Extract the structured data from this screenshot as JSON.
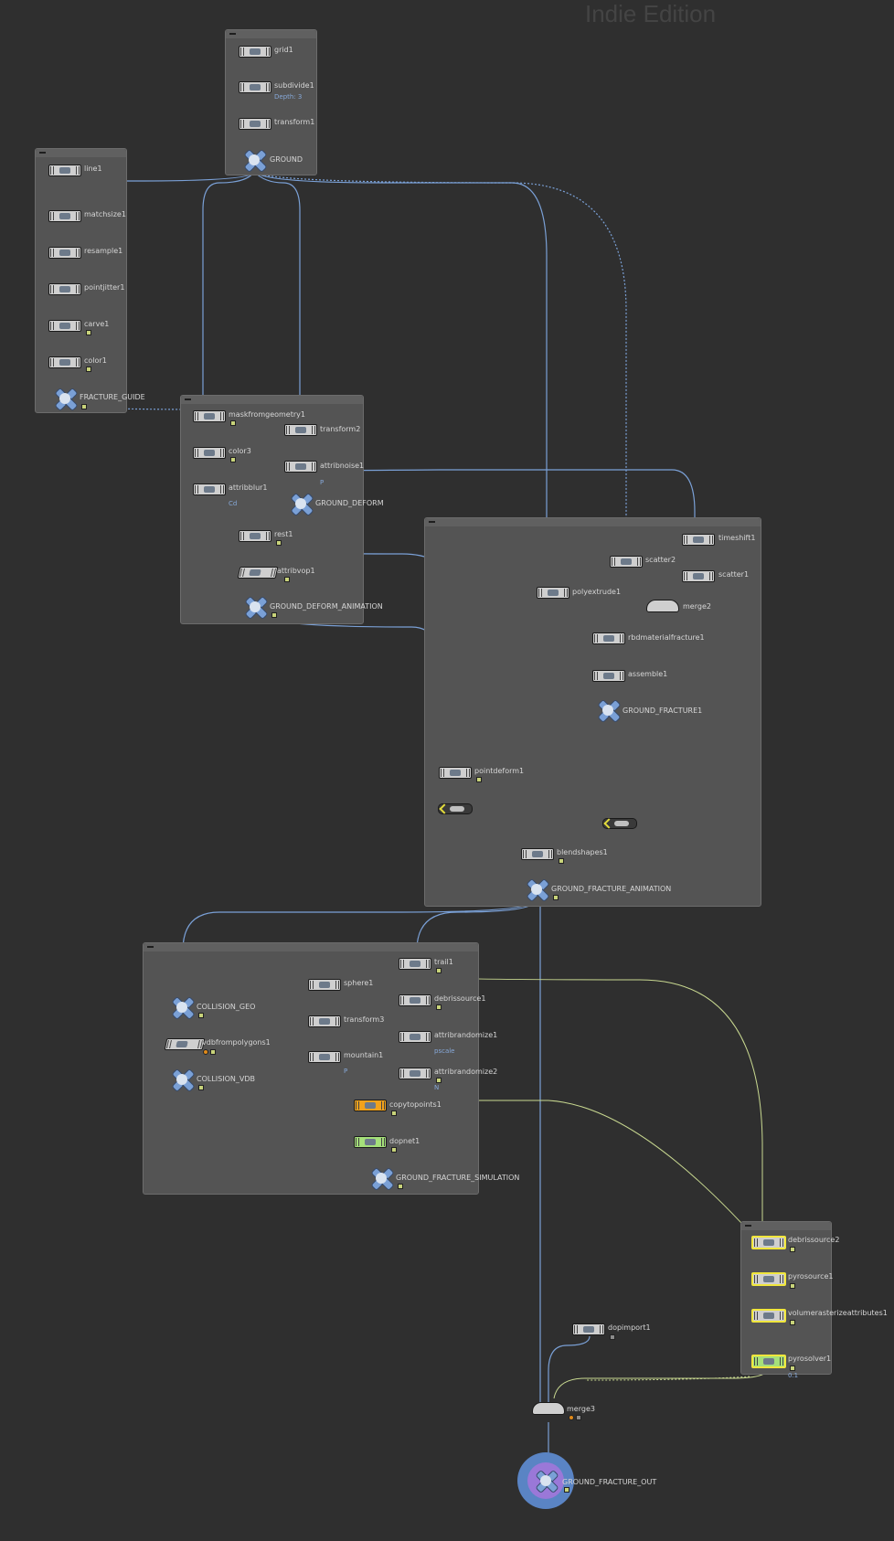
{
  "watermark": "Indie Edition",
  "colors": {
    "background": "#2f2f2f",
    "network_box": "#545454",
    "wire": "#7aa0d6",
    "wire_pyro": "#c8d890",
    "node_default": "#cfcfcf",
    "copytopoints": "#f2a21b",
    "dopnet": "#a5e07a",
    "output_ring": "#5a84c4",
    "output_core": "#9a78d8",
    "selected_outline": "#f0e63c",
    "display_flag": "#c8d37a"
  },
  "nodes": {
    "grid1": {
      "label": "grid1",
      "icon": "grid-icon"
    },
    "subdivide1": {
      "label": "subdivide1",
      "param": "Depth: 3",
      "icon": "subdivide-icon"
    },
    "transform1": {
      "label": "transform1",
      "icon": "transform-icon"
    },
    "ground": {
      "label": "GROUND",
      "icon": "null-icon"
    },
    "line1": {
      "label": "line1",
      "icon": "line-icon"
    },
    "matchsize1": {
      "label": "matchsize1",
      "icon": "matchsize-icon"
    },
    "resample1": {
      "label": "resample1",
      "icon": "resample-icon"
    },
    "pointjitter1": {
      "label": "pointjitter1",
      "icon": "pointjitter-icon"
    },
    "carve1": {
      "label": "carve1",
      "icon": "carve-icon"
    },
    "color1": {
      "label": "color1",
      "icon": "color-icon"
    },
    "fracture_guide": {
      "label": "FRACTURE_GUIDE",
      "icon": "null-icon"
    },
    "maskfromgeometry1": {
      "label": "maskfromgeometry1",
      "icon": "mask-icon"
    },
    "transform2": {
      "label": "transform2",
      "icon": "transform-icon"
    },
    "color3": {
      "label": "color3",
      "icon": "color-icon"
    },
    "attribnoise1": {
      "label": "attribnoise1",
      "param": "P",
      "icon": "noise-icon"
    },
    "attribblur1": {
      "label": "attribblur1",
      "param": "Cd",
      "icon": "blur-icon"
    },
    "ground_deform": {
      "label": "GROUND_DEFORM",
      "icon": "null-icon"
    },
    "rest1": {
      "label": "rest1",
      "icon": "rest-icon"
    },
    "attribvop1": {
      "label": "attribvop1",
      "icon": "vop-icon"
    },
    "ground_deform_animation": {
      "label": "GROUND_DEFORM_ANIMATION",
      "icon": "null-icon"
    },
    "timeshift1": {
      "label": "timeshift1",
      "icon": "timeshift-icon"
    },
    "scatter2": {
      "label": "scatter2",
      "icon": "scatter-icon"
    },
    "scatter1": {
      "label": "scatter1",
      "icon": "scatter-icon"
    },
    "polyextrude1": {
      "label": "polyextrude1",
      "icon": "polyextrude-icon"
    },
    "merge2": {
      "label": "merge2",
      "icon": "merge-icon"
    },
    "rbdmaterialfracture1": {
      "label": "rbdmaterialfracture1",
      "icon": "fracture-icon"
    },
    "assemble1": {
      "label": "assemble1",
      "icon": "assemble-icon"
    },
    "ground_fracture1": {
      "label": "GROUND_FRACTURE1",
      "icon": "null-icon"
    },
    "pointdeform1": {
      "label": "pointdeform1",
      "icon": "pointdeform-icon"
    },
    "blendshapes1": {
      "label": "blendshapes1",
      "icon": "blendshapes-icon"
    },
    "ground_fracture_animation": {
      "label": "GROUND_FRACTURE_ANIMATION",
      "icon": "null-icon"
    },
    "collision_geo": {
      "label": "COLLISION_GEO",
      "icon": "null-icon"
    },
    "vdbfrompolygons1": {
      "label": "vdbfrompolygons1",
      "icon": "vdb-icon"
    },
    "collision_vdb": {
      "label": "COLLISION_VDB",
      "icon": "null-icon"
    },
    "sphere1": {
      "label": "sphere1",
      "icon": "sphere-icon"
    },
    "transform3": {
      "label": "transform3",
      "icon": "transform-icon"
    },
    "mountain1": {
      "label": "mountain1",
      "param": "P",
      "icon": "mountain-icon"
    },
    "trail1": {
      "label": "trail1",
      "icon": "trail-icon"
    },
    "debrissource1": {
      "label": "debrissource1",
      "icon": "debris-icon"
    },
    "attribrandomize1": {
      "label": "attribrandomize1",
      "param": "pscale",
      "icon": "randomize-icon"
    },
    "attribrandomize2": {
      "label": "attribrandomize2",
      "param": "N",
      "icon": "randomize-icon"
    },
    "copytopoints1": {
      "label": "copytopoints1",
      "icon": "copy-icon"
    },
    "dopnet1": {
      "label": "dopnet1",
      "icon": "dopnet-icon"
    },
    "ground_fracture_simulation": {
      "label": "GROUND_FRACTURE_SIMULATION",
      "icon": "null-icon"
    },
    "debrissource2": {
      "label": "debrissource2",
      "icon": "debris-icon"
    },
    "pyrosource1": {
      "label": "pyrosource1",
      "icon": "pyro-icon"
    },
    "volumerasterizeattributes1": {
      "label": "volumerasterizeattributes1",
      "icon": "rasterize-icon"
    },
    "pyrosolver1": {
      "label": "pyrosolver1",
      "param": "0.1",
      "icon": "pyrosolver-icon"
    },
    "dopimport1": {
      "label": "dopimport1",
      "icon": "dopimport-icon"
    },
    "merge3": {
      "label": "merge3",
      "icon": "merge-icon"
    },
    "ground_fracture_out": {
      "label": "GROUND_FRACTURE_OUT",
      "icon": "output-icon"
    }
  }
}
